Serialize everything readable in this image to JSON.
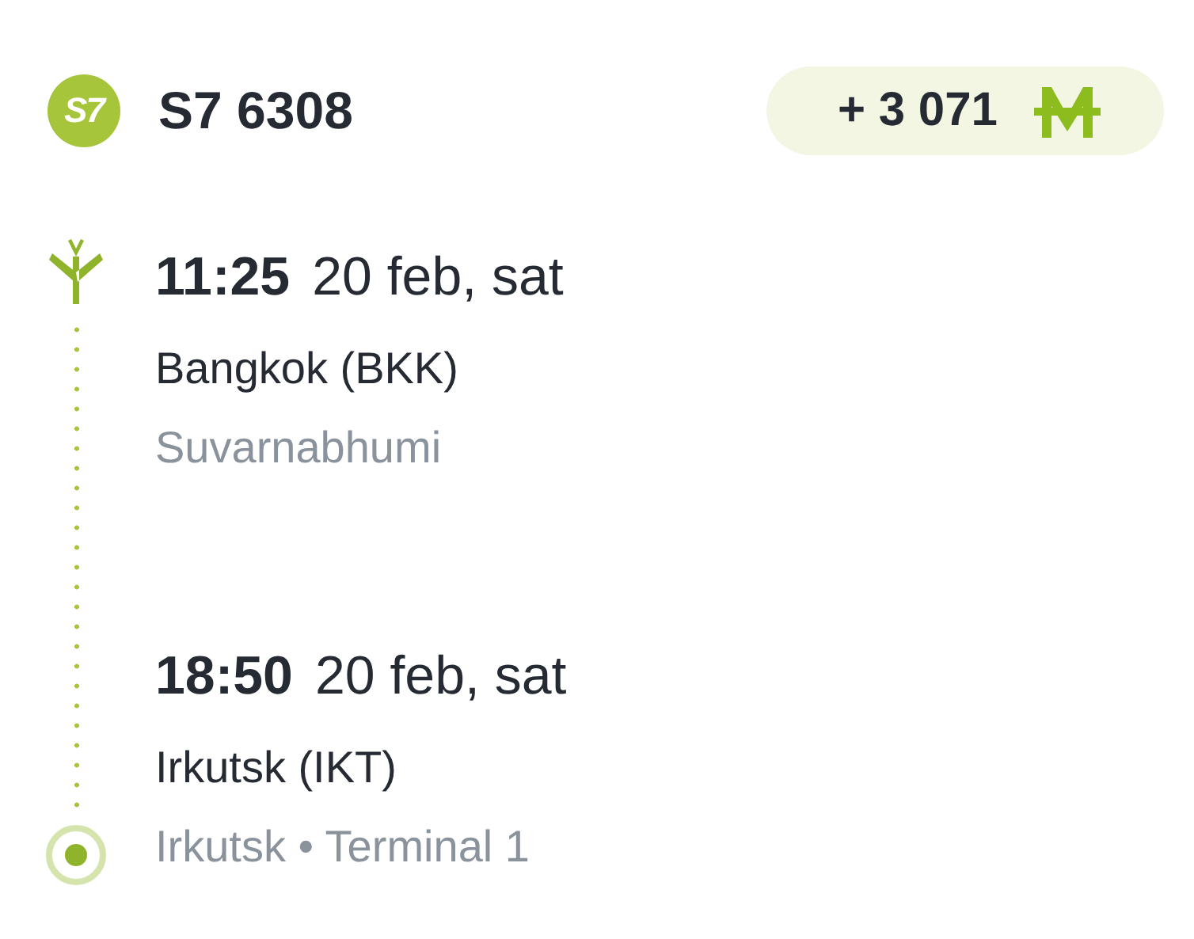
{
  "flight": {
    "logo_text": "S7",
    "number": "S7 6308"
  },
  "miles_badge": {
    "amount": "+ 3 071"
  },
  "stops": [
    {
      "kind": "departure",
      "time": "11:25",
      "date": "20 feb, sat",
      "city": "Bangkok (BKK)",
      "airport": "Suvarnabhumi"
    },
    {
      "kind": "arrival",
      "time": "18:50",
      "date": "20 feb, sat",
      "city": "Irkutsk (IKT)",
      "airport": "Irkutsk • Terminal 1"
    }
  ]
}
